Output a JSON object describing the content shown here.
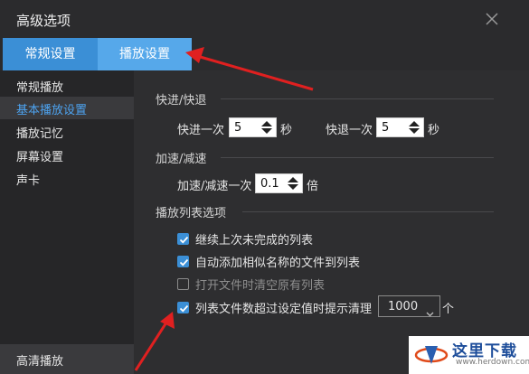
{
  "window": {
    "title": "高级选项"
  },
  "tabs": [
    {
      "label": "常规设置"
    },
    {
      "label": "播放设置"
    }
  ],
  "sidebar": {
    "items": [
      {
        "label": "常规播放",
        "active": false
      },
      {
        "label": "基本播放设置",
        "active": true
      },
      {
        "label": "播放记忆",
        "active": false
      },
      {
        "label": "屏幕设置",
        "active": false
      },
      {
        "label": "声卡",
        "active": false
      }
    ],
    "bottom_item": {
      "label": "高清播放"
    }
  },
  "seek": {
    "heading": "快进/快退",
    "forward_label": "快进一次",
    "forward_value": "5",
    "forward_unit": "秒",
    "backward_label": "快退一次",
    "backward_value": "5",
    "backward_unit": "秒"
  },
  "speed": {
    "heading": "加速/减速",
    "label": "加速/减速一次",
    "value": "0.1",
    "unit": "倍"
  },
  "playlist": {
    "heading": "播放列表选项",
    "options": [
      {
        "label": "继续上次未完成的列表",
        "checked": true
      },
      {
        "label": "自动添加相似名称的文件到列表",
        "checked": true
      },
      {
        "label": "打开文件时清空原有列表",
        "checked": false
      },
      {
        "label": "列表文件数超过设定值时提示清理",
        "checked": true
      }
    ],
    "limit_value": "1000",
    "limit_unit": "个"
  },
  "watermark": {
    "title": "这里下载",
    "url": "www.herdown.com"
  },
  "colors": {
    "accent": "#3b8fd6",
    "tab_active": "#56a8ea",
    "annotation_arrow": "#e02020"
  }
}
